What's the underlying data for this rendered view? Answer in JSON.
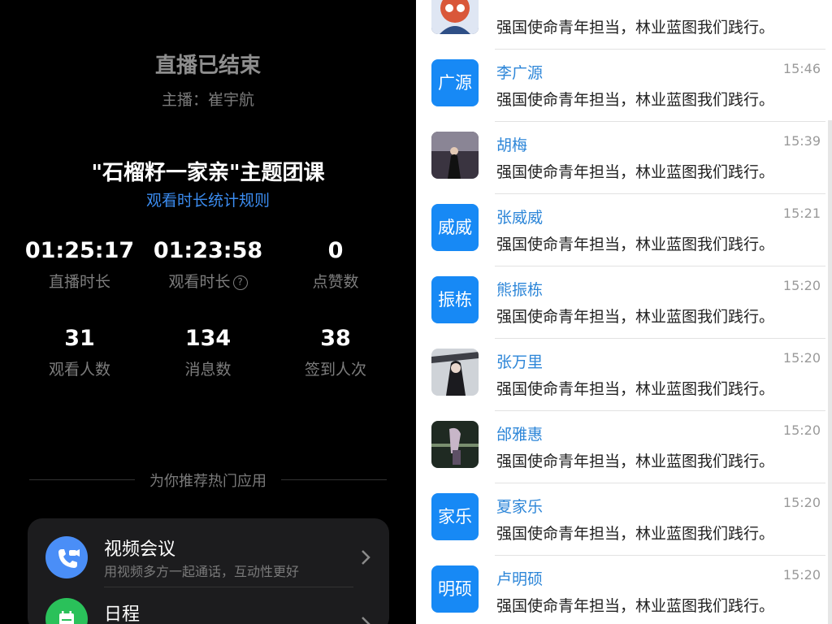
{
  "live": {
    "status_title": "直播已结束",
    "host_line": "主播：崔宇航",
    "course_title": "\"石榴籽一家亲\"主题团课",
    "rules_link": "观看时长统计规则",
    "stats": [
      {
        "value": "01:25:17",
        "label": "直播时长"
      },
      {
        "value": "01:23:58",
        "label": "观看时长"
      },
      {
        "value": "0",
        "label": "点赞数"
      },
      {
        "value": "31",
        "label": "观看人数"
      },
      {
        "value": "134",
        "label": "消息数"
      },
      {
        "value": "38",
        "label": "签到人次"
      }
    ],
    "help_icon": "question-circle-icon"
  },
  "recommend": {
    "title": "为你推荐热门应用",
    "apps": [
      {
        "name": "视频会议",
        "desc": "用视频多方一起通话，互动性更好",
        "icon": "video-call-icon",
        "color": "#4a8ef7"
      },
      {
        "name": "日程",
        "desc": "",
        "icon": "calendar-icon",
        "color": "#2ac15a"
      }
    ]
  },
  "chat": {
    "messages": [
      {
        "name": "",
        "time": "",
        "avatar_text": "",
        "content": "强国使命青年担当，林业蓝图我们践行。"
      },
      {
        "name": "李广源",
        "time": "15:46",
        "avatar_text": "广源",
        "content": "强国使命青年担当，林业蓝图我们践行。"
      },
      {
        "name": "胡梅",
        "time": "15:39",
        "avatar_text": "",
        "content": "强国使命青年担当，林业蓝图我们践行。"
      },
      {
        "name": "张威威",
        "time": "15:21",
        "avatar_text": "威威",
        "content": "强国使命青年担当，林业蓝图我们践行。"
      },
      {
        "name": "熊振栋",
        "time": "15:20",
        "avatar_text": "振栋",
        "content": "强国使命青年担当，林业蓝图我们践行。"
      },
      {
        "name": "张万里",
        "time": "15:20",
        "avatar_text": "",
        "content": "强国使命青年担当，林业蓝图我们践行。"
      },
      {
        "name": "邰雅惠",
        "time": "15:20",
        "avatar_text": "",
        "content": "强国使命青年担当，林业蓝图我们践行。"
      },
      {
        "name": "夏家乐",
        "time": "15:20",
        "avatar_text": "家乐",
        "content": "强国使命青年担当，林业蓝图我们践行。"
      },
      {
        "name": "卢明硕",
        "time": "15:20",
        "avatar_text": "明硕",
        "content": "强国使命青年担当，林业蓝图我们践行。"
      }
    ]
  }
}
